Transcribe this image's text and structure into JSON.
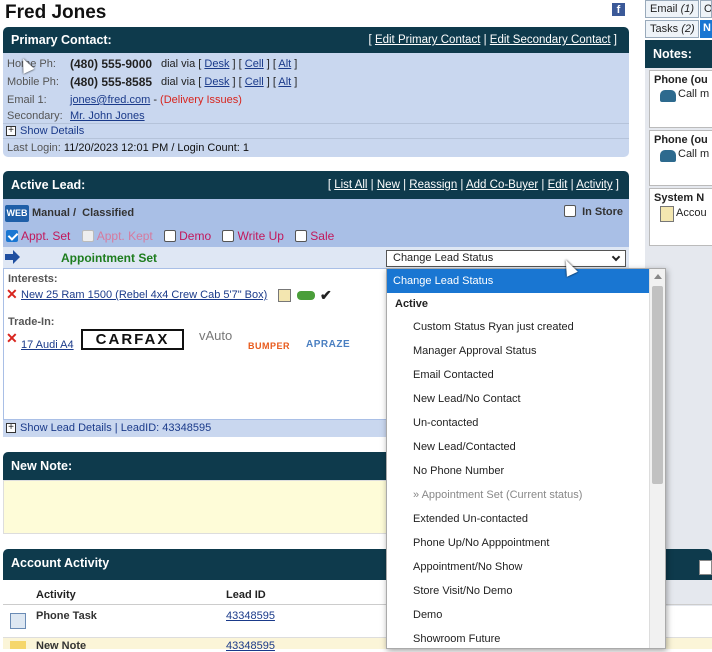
{
  "customer": {
    "name": "Fred Jones"
  },
  "right_tabs": {
    "email_label": "Email",
    "email_count": "(1)",
    "other_label": "O",
    "tasks_label": "Tasks",
    "tasks_count": "(2)",
    "active_tab": "N"
  },
  "notes_panel": {
    "title": "Notes:",
    "items": [
      {
        "title": "Phone (ou",
        "text": "Call m"
      },
      {
        "title": "Phone (ou",
        "text": "Call m"
      },
      {
        "title": "System N",
        "text": "Accou"
      }
    ]
  },
  "primary_contact": {
    "title": "Primary Contact:",
    "edit_primary": "Edit Primary Contact",
    "edit_secondary": "Edit Secondary Contact",
    "home_label": "Home Ph:",
    "home_phone": "(480) 555-9000",
    "mobile_label": "Mobile Ph:",
    "mobile_phone": "(480) 555-8585",
    "dial_via": "dial via",
    "desk": "Desk",
    "cell": "Cell",
    "alt": "Alt",
    "email_label": "Email 1:",
    "email": "jones@fred.com",
    "delivery_issues": "(Delivery Issues)",
    "secondary_label": "Secondary:",
    "secondary": "Mr. John Jones",
    "show_details": "Show Details",
    "last_login": "Last Login:",
    "last_login_value": "11/20/2023 12:01 PM / Login Count: 1"
  },
  "active_lead": {
    "title": "Active Lead:",
    "links": [
      "List All",
      "New",
      "Reassign",
      "Add Co-Buyer",
      "Edit",
      "Activity"
    ],
    "source_badge": "WEB",
    "source": "Manual /",
    "source_type": "Classified",
    "in_store": "In Store",
    "checks": [
      {
        "label": "Appt. Set",
        "checked": true
      },
      {
        "label": "Appt. Kept",
        "checked": false
      },
      {
        "label": "Demo",
        "checked": false
      },
      {
        "label": "Write Up",
        "checked": false
      },
      {
        "label": "Sale",
        "checked": false
      }
    ],
    "status": "Appointment Set",
    "status_select": "Change Lead Status",
    "interests_label": "Interests:",
    "vehicle": "New 25 Ram 1500 (Rebel 4x4 Crew Cab 5'7\" Box)",
    "tradein_label": "Trade-In:",
    "tradein_vehicle": "17 Audi A4",
    "logos": {
      "carfax": "CARFAX",
      "vauto": "vAuto",
      "bumper": "BUMPER",
      "apraze": "APRAZE"
    },
    "show_lead_details": "Show Lead Details | LeadID: 43348595"
  },
  "new_note": {
    "title": "New Note:"
  },
  "account_activity": {
    "title": "Account Activity",
    "columns": [
      "Activity",
      "Lead ID"
    ],
    "rows": [
      {
        "activity": "Phone Task",
        "lead_id": "43348595"
      },
      {
        "activity": "New Note",
        "lead_id": "43348595"
      }
    ]
  },
  "dropdown": {
    "selected": "Change Lead Status",
    "group": "Active",
    "options": [
      "Custom Status Ryan just created",
      "Manager Approval Status",
      "Email Contacted",
      "New Lead/No Contact",
      "Un-contacted",
      "New Lead/Contacted",
      "No Phone Number",
      "» Appointment Set (Current status)",
      "Extended Un-contacted",
      "Phone Up/No Apppointment",
      "Appointment/No Show",
      "Store Visit/No Demo",
      "Demo",
      "Showroom Future"
    ]
  }
}
